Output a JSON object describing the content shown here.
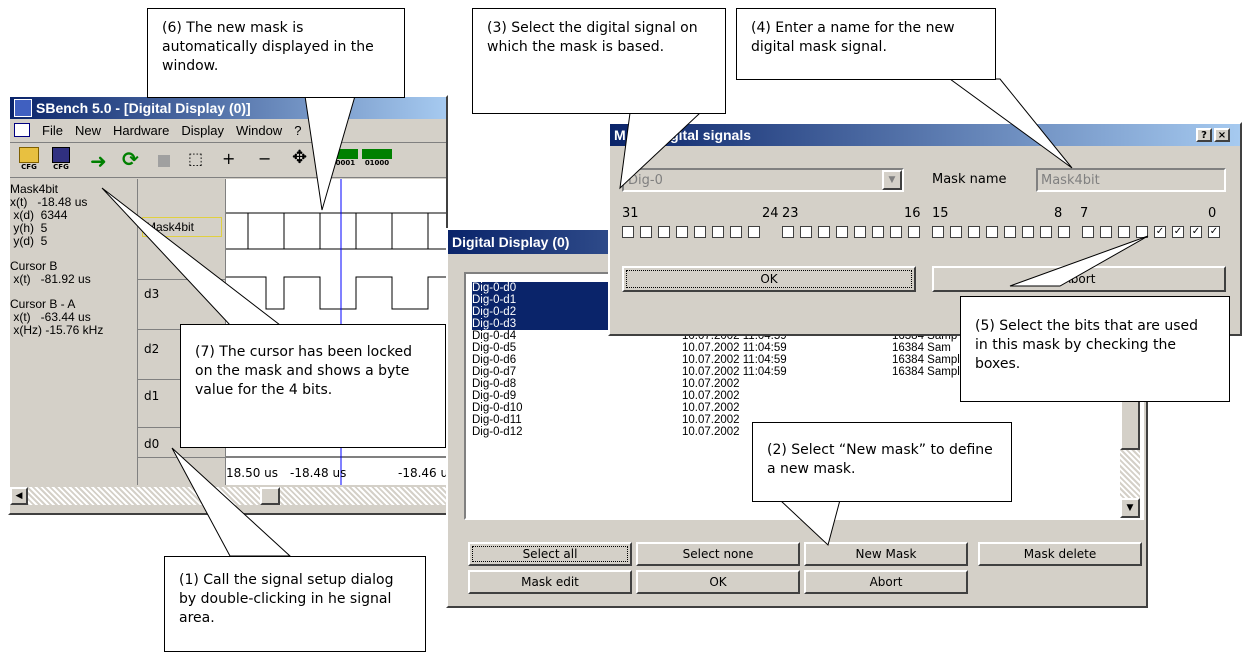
{
  "sbench": {
    "title": "SBench 5.0 - [Digital Display (0)]",
    "menu": [
      "File",
      "New",
      "Hardware",
      "Display",
      "Window",
      "?"
    ],
    "toolbar_icons": [
      "open-cfg-icon",
      "save-cfg-icon",
      "arrow-right-icon",
      "refresh-icon",
      "stop-icon",
      "zoom-rect-icon",
      "zoom-plus-icon",
      "zoom-minus-icon",
      "move-icon",
      "bits-00001-icon",
      "bits-01000-icon"
    ],
    "toolbar_labels": {
      "cfg1": "CFG",
      "cfg2": "CFG",
      "bits1": "00001",
      "bits2": "01000"
    },
    "info": {
      "signal": "Mask4bit",
      "xt": "x(t)   -18.48 us",
      "xd": " x(d)  6344",
      "yh": " y(h)  5",
      "yd": " y(d)  5",
      "cursorb": "Cursor B",
      "cursorb_xt": " x(t)   -81.92 us",
      "cursorba": "Cursor B - A",
      "cursorba_xt": " x(t)   -63.44 us",
      "cursorba_xhz": " x(Hz) -15.76 kHz"
    },
    "signals": [
      "Mask4bit",
      "d3",
      "d2",
      "d1",
      "d0"
    ],
    "axis_ticks": [
      "18.50 us",
      "-18.48 us",
      "-18.46 u"
    ]
  },
  "digital_display": {
    "title": "Digital Display (0)",
    "rows": [
      {
        "name": "Dig-0-d0",
        "date": "",
        "samples": "",
        "selected": true
      },
      {
        "name": "Dig-0-d1",
        "date": "",
        "samples": "",
        "selected": true
      },
      {
        "name": "Dig-0-d2",
        "date": "",
        "samples": "",
        "selected": true
      },
      {
        "name": "Dig-0-d3",
        "date": "10.07.2002 11:04:59",
        "samples": "16384 Sam",
        "selected": true
      },
      {
        "name": "Dig-0-d4",
        "date": "10.07.2002 11:04:59",
        "samples": "16384 Samp",
        "selected": false
      },
      {
        "name": "Dig-0-d5",
        "date": "10.07.2002 11:04:59",
        "samples": "16384 Sam",
        "selected": false
      },
      {
        "name": "Dig-0-d6",
        "date": "10.07.2002 11:04:59",
        "samples": "16384 Samples",
        "selected": false
      },
      {
        "name": "Dig-0-d7",
        "date": "10.07.2002 11:04:59",
        "samples": "16384 Samples",
        "selected": false
      },
      {
        "name": "Dig-0-d8",
        "date": "10.07.2002",
        "samples": "",
        "selected": false
      },
      {
        "name": "Dig-0-d9",
        "date": "10.07.2002",
        "samples": "",
        "selected": false
      },
      {
        "name": "Dig-0-d10",
        "date": "10.07.2002",
        "samples": "",
        "selected": false
      },
      {
        "name": "Dig-0-d11",
        "date": "10.07.2002",
        "samples": "",
        "selected": false
      },
      {
        "name": "Dig-0-d12",
        "date": "10.07.2002",
        "samples": "",
        "selected": false
      }
    ],
    "buttons": {
      "select_all": "Select all",
      "select_none": "Select none",
      "new_mask": "New Mask",
      "mask_delete": "Mask delete",
      "mask_edit": "Mask edit",
      "ok": "OK",
      "abort": "Abort"
    }
  },
  "mask_dialog": {
    "title": "Mask digital signals",
    "title_visible_start": "M",
    "title_visible_end": "digital signals",
    "help": "?",
    "close": "×",
    "signal_select_value": "Dig-0",
    "mask_name_label": "Mask name",
    "mask_name_value": "Mask4bit",
    "bit_labels": [
      "31",
      "24",
      "23",
      "16",
      "15",
      "8",
      "7",
      "0"
    ],
    "checked_bits": [
      3,
      2,
      1,
      0
    ],
    "ok": "OK",
    "abort": "Abort"
  },
  "callouts": {
    "c1": "(1) Call the signal setup dialog by double-clicking in he signal area.",
    "c2": "(2) Select “New mask” to define a new mask.",
    "c3": "(3) Select the digital signal on which the mask is based.",
    "c4": "(4) Enter a name for the new digital mask signal.",
    "c5": "(5) Select the bits that are used in this mask by checking the boxes.",
    "c6": "(6) The new mask is automatically displayed in the window.",
    "c7": "(7) The cursor has been locked on the mask and shows a byte value for the 4 bits."
  },
  "colors": {
    "title_active": "#0a246a",
    "selection": "#0a246a",
    "cursor_line": "#0000ff",
    "face": "#d4d0c8"
  }
}
